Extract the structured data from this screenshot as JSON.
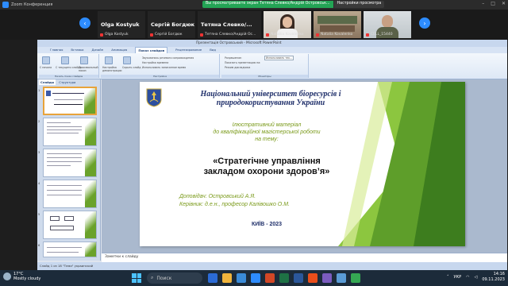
{
  "zoom": {
    "window_title": "Zoom Конференция",
    "share_status": "Вы просматриваете экран Тетяна Слевко/Андрій Островськ...",
    "share_button": "Настройки просмотра",
    "participants": [
      {
        "display": "Olga Kostyuk",
        "label": "Olga Kostyuk",
        "type": "name"
      },
      {
        "display": "Сергій Богдюк",
        "label": "Сергій Богдюк",
        "type": "name"
      },
      {
        "display": "Тетяна Слевко/...",
        "label": "Тетяна Слевко/Андрій Ос...",
        "type": "name"
      },
      {
        "display": "",
        "label": "Nataliia Kovalenko",
        "type": "video-woman"
      },
      {
        "display": "",
        "label": "Natalia Kovalenko",
        "type": "video-room"
      },
      {
        "display": "",
        "label": "CELL_15440",
        "type": "video-man"
      }
    ]
  },
  "powerpoint": {
    "title": "Презентація Островський - Microsoft PowerPoint",
    "tabs": [
      "Главная",
      "Вставка",
      "Дизайн",
      "Анимация",
      "Показ слайдов",
      "Рецензирование",
      "Вид"
    ],
    "active_tab": "Показ слайдов",
    "ribbon": {
      "group1": "Начать показ слайдов",
      "group1_buttons": [
        "С начала",
        "С текущего слайда",
        "Произвольный показ"
      ],
      "group2": "Настройка",
      "group2_buttons": [
        "Настройка демонстрации",
        "Скрыть слайд"
      ],
      "group2_checks": [
        "Звукозапись речевого сопровождения",
        "Настройка времени",
        "Использовать записанное время"
      ],
      "group3": "Мониторы",
      "group3_checks": [
        "Разрешение:",
        "Показать презентацию на:",
        "Режим докладчика"
      ],
      "resolution_value": "Использовать тек..."
    },
    "left_tabs": [
      "Слайды",
      "Структура"
    ],
    "thumbnails": [
      "1",
      "2",
      "3",
      "4",
      "5",
      "6"
    ],
    "notes_placeholder": "Заметки к слайду",
    "status": "Слайд 1 из 18   \"Тема\"   украинский",
    "slide": {
      "title_line1": "Національний університет біоресурсів і",
      "title_line2": "природокористування України",
      "intro_line1": "Ілюстративний матеріал",
      "intro_line2": "до кваліфікаційної магістерської роботи",
      "intro_line3": "на тему:",
      "topic_line1": "«Стратегічне управління",
      "topic_line2": "закладом охорони здоров’я»",
      "speaker": "Доповідач: Островський  А.Я.",
      "supervisor": "Керівник: д.е.н., професор Калівошко О.М.",
      "city_year": "КИЇВ - 2023"
    }
  },
  "taskbar": {
    "weather_temp": "17°C",
    "weather_desc": "Mostly cloudy",
    "search": "Поиск",
    "lang": "УКР",
    "time": "14:16",
    "date": "09.11.2023"
  }
}
